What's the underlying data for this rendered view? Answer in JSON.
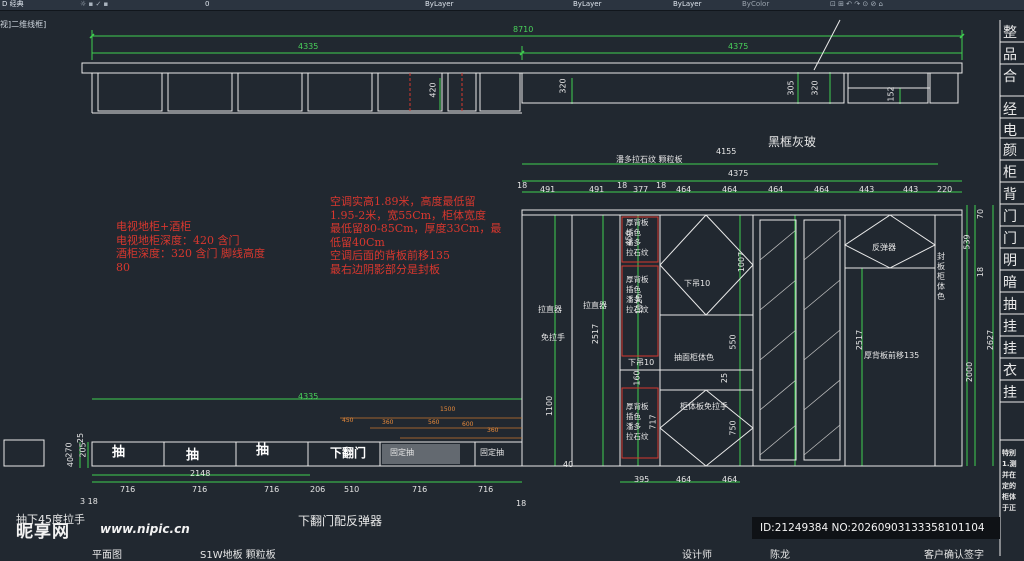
{
  "toolbar": {
    "workspace": "D 经典",
    "layer": "0",
    "bylayer1": "ByLayer",
    "bylayer2": "ByLayer",
    "bylayer3": "ByLayer",
    "bycolor": "ByColor"
  },
  "viewport_label": "视]二维线框]",
  "drawing": {
    "dims": {
      "total": "8710",
      "left_width": "4335",
      "right_width": "4375",
      "h420": "420",
      "h320a": "320",
      "h305": "305",
      "h320b": "320",
      "h152": "152",
      "w4155": "4155",
      "w4375": "4375",
      "w4335_low": "4335",
      "w2148": "2148",
      "h270": "270",
      "h40": "40",
      "h205": "205",
      "h25": "25",
      "h1100": "1100",
      "h2517a": "2517",
      "h450": "450",
      "h1020": "1020",
      "h160": "160",
      "h717": "717",
      "h1007": "1007",
      "h550": "550",
      "h750": "750",
      "h25b": "25",
      "h2517b": "2517",
      "h539": "539",
      "h18r": "18",
      "h70": "70",
      "h2000": "2000",
      "h2627": "2627",
      "h40b": "40",
      "w395": "395",
      "w464a": "464",
      "w464b": "464",
      "bottom_start": "3 18",
      "bottom_end": "18"
    },
    "top_segments": [
      "18",
      "491",
      "491",
      "18",
      "377",
      "18",
      "464",
      "464",
      "464",
      "464",
      "443",
      "443",
      "220"
    ],
    "bottom_segments": [
      "716",
      "716",
      "716",
      "206",
      "510",
      "716",
      "716"
    ],
    "small_dims": [
      "450",
      "360",
      "560",
      "1500",
      "600",
      "360"
    ],
    "labels": {
      "black_frame": "黑框灰玻",
      "panel_type": "潘多拉石纹 颗粒板",
      "flip_door": "下翻门配反弹器",
      "drawer1": "抽",
      "drawer2": "抽",
      "drawer3": "抽",
      "flip_door_small": "下翻门",
      "fixed1": "固定抽",
      "fixed2": "固定抽",
      "straightener1": "拉直器",
      "straightener2": "拉直器",
      "no_handle": "免拉手",
      "thick_back_1": [
        "厚背板",
        "插色",
        "潘多",
        "拉石纹"
      ],
      "thick_back_2": [
        "厚背板",
        "插色",
        "潘多",
        "拉石纹"
      ],
      "thick_back_3": [
        "厚背板",
        "插色",
        "潘多",
        "拉石纹"
      ],
      "lower_hang_1": "下吊10",
      "lower_hang_2": "下吊10",
      "drawer_face": "抽面柜体色",
      "cabinet_no_handle": "柜体板免拉手",
      "rebounder": "反弹器",
      "thick_back_move": "厚背板前移135",
      "sealing": [
        "封",
        "板",
        "柜",
        "体",
        "色"
      ],
      "drawer_45": "抽下45度拉手"
    },
    "notes": {
      "tv_cabinet": [
        "电视地柜+酒柜",
        "电视地柜深度：420 含门",
        "酒柜深度：320 含门 脚线高度",
        "80"
      ],
      "aircon": [
        "空调实高1.89米，高度最低留",
        "1.95-2米，宽55Cm，柜体宽度",
        "最低留80-85Cm，厚度33Cm，最",
        "低留40Cm",
        "空调后面的背板前移135",
        "最右边阴影部分是封板"
      ]
    }
  },
  "right_column": {
    "items": [
      "整",
      "品",
      "合",
      "经",
      "电",
      "颜",
      "柜",
      "背",
      "门",
      "门",
      "明",
      "暗",
      "抽",
      "挂",
      "挂",
      "衣",
      "挂"
    ],
    "special_note": [
      "特别",
      "1.测",
      "并在",
      "定的",
      "柜体",
      "于正"
    ]
  },
  "watermark": {
    "brand": "昵享网",
    "site": "www.nipic.cn"
  },
  "id_stamp": "ID:21249384 NO:20260903133358101104",
  "bottom_row": {
    "left": "平面图",
    "mid": "S1W地板 颗粒板",
    "designer": "设计师",
    "designer_name": "陈龙",
    "client": "客户确认签字"
  }
}
